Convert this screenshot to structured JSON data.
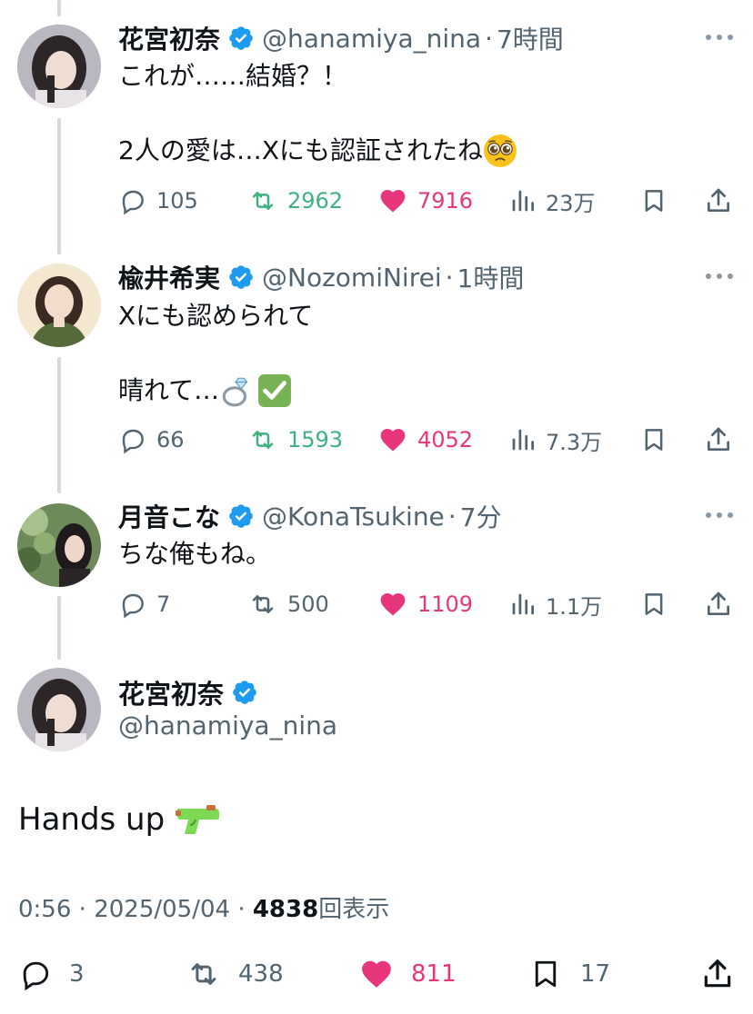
{
  "tweets": [
    {
      "name": "花宮初奈",
      "handle": "@hanamiya_nina",
      "time": "7時間",
      "line1": "これが……結婚？！",
      "line2": "2人の愛は…Xにも認証されたね",
      "reply_count": "105",
      "retweet_count": "2962",
      "like_count": "7916",
      "view_count": "23万",
      "avatar_icon": "hanamiya-avatar",
      "emoji_icon": "pleading-face-icon"
    },
    {
      "name": "楡井希実",
      "handle": "@NozomiNirei",
      "time": "1時間",
      "line1": "Xにも認められて",
      "line2": "晴れて…",
      "reply_count": "66",
      "retweet_count": "1593",
      "like_count": "4052",
      "view_count": "7.3万",
      "avatar_icon": "nirei-avatar",
      "emoji_icons": [
        "ring-icon",
        "check-mark-button-icon"
      ]
    },
    {
      "name": "月音こな",
      "handle": "@KonaTsukine",
      "time": "7分",
      "line1": "ちな俺もね。",
      "reply_count": "7",
      "retweet_count": "500",
      "like_count": "1109",
      "view_count": "1.1万",
      "avatar_icon": "tsukine-avatar"
    }
  ],
  "main_tweet": {
    "name": "花宮初奈",
    "handle": "@hanamiya_nina",
    "text": "Hands up",
    "emoji_icon": "water-pistol-icon",
    "time": "0:56",
    "date": "2025/05/04",
    "separator": "·",
    "views": "4838",
    "views_label": "回表示",
    "reply_count": "3",
    "retweet_count": "438",
    "like_count": "811",
    "bookmark_count": "17"
  },
  "colors": {
    "text": "#0f1419",
    "secondary": "#536471",
    "verified": "#1d9bf0",
    "retweet_active": "#3fb27f",
    "like_active": "#e8367d",
    "thread_line": "#cfd9de"
  }
}
